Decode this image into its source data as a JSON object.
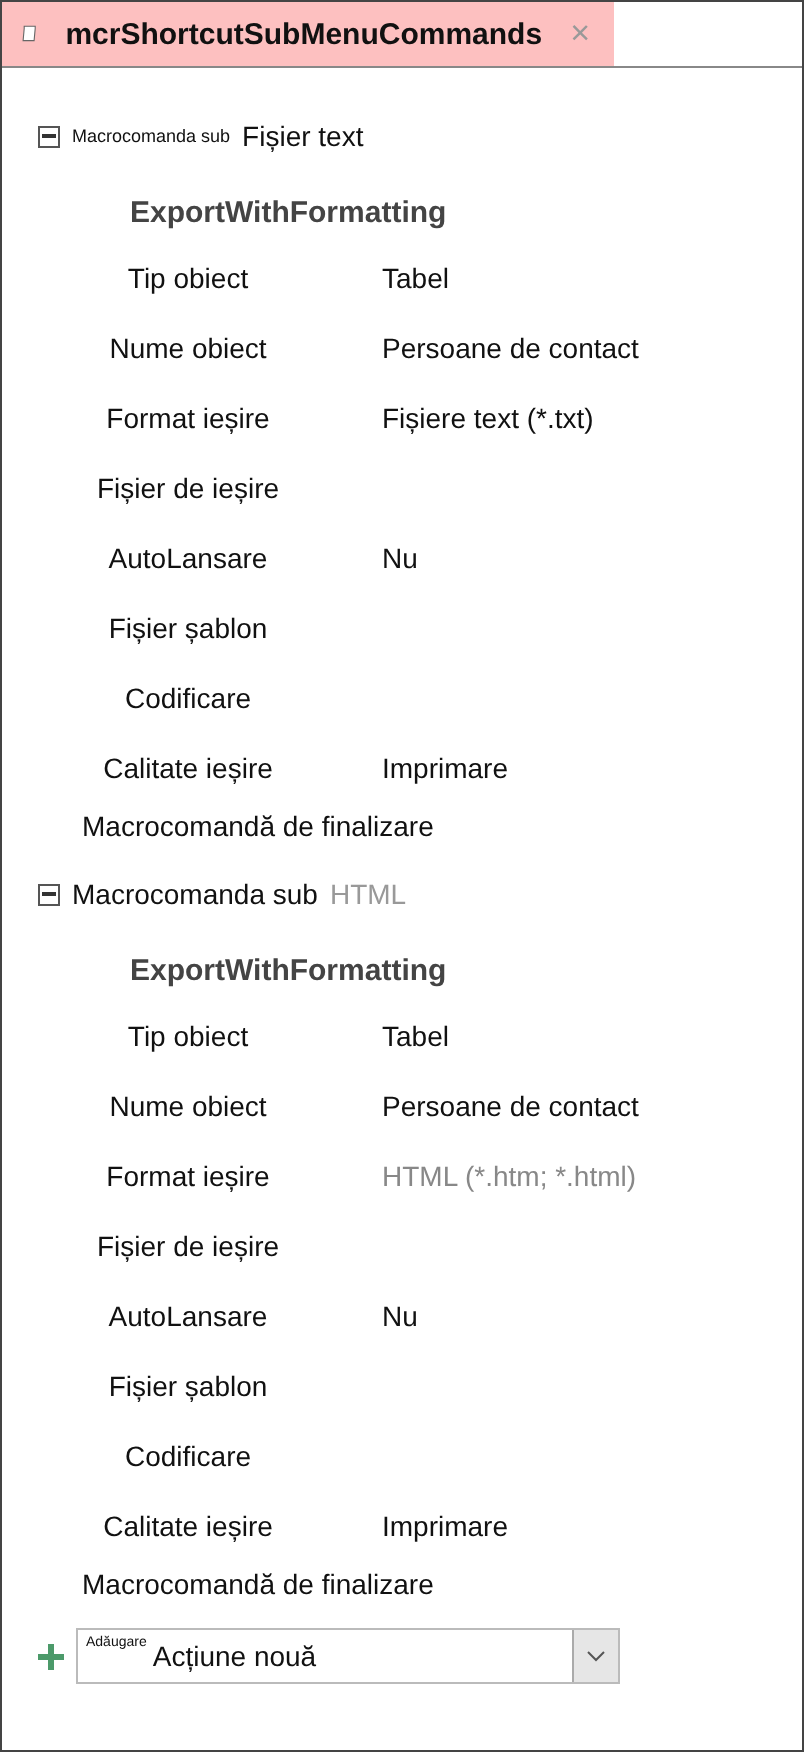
{
  "tab": {
    "title": "mcrShortcutSubMenuCommands",
    "close": "×",
    "selected": true
  },
  "submacros": [
    {
      "expanded": true,
      "label": "Macrocomanda sub",
      "label_small": true,
      "name": "Fișier text",
      "name_dimmed": false,
      "action": "ExportWithFormatting",
      "arguments": [
        {
          "label": "Tip obiect",
          "value": "Tabel",
          "dimmed": false
        },
        {
          "label": "Nume obiect",
          "value": "Persoane de contact",
          "dimmed": false
        },
        {
          "label": "Format ieșire",
          "value": "Fișiere text (*.txt)",
          "dimmed": false
        },
        {
          "label": "Fișier de ieșire"
        },
        {
          "label": "AutoLansare",
          "value": "Nu",
          "dimmed": false
        },
        {
          "label": "Fișier șablon"
        },
        {
          "label": "Codificare"
        },
        {
          "label": "Calitate ieșire",
          "value": "Imprimare",
          "dimmed": false
        }
      ],
      "end": "Macrocomandă de finalizare"
    },
    {
      "expanded": true,
      "label": "Macrocomanda sub",
      "label_small": false,
      "name": "HTML",
      "name_dimmed": true,
      "action": "ExportWithFormatting",
      "arguments": [
        {
          "label": "Tip obiect",
          "value": "Tabel",
          "dimmed": false
        },
        {
          "label": "Nume obiect",
          "value": "Persoane de contact",
          "dimmed": false
        },
        {
          "label": "Format ieșire",
          "value": "HTML (*.htm; *.html)",
          "dimmed": true
        },
        {
          "label": "Fișier de ieșire"
        },
        {
          "label": "AutoLansare",
          "value": "Nu",
          "dimmed": false
        },
        {
          "label": "Fișier șablon"
        },
        {
          "label": "Codificare"
        },
        {
          "label": "Calitate ieșire",
          "value": "Imprimare",
          "dimmed": false
        }
      ],
      "end": "Macrocomandă de finalizare"
    }
  ],
  "add_action": {
    "label": "Adăugare",
    "value": "Acțiune nouă"
  }
}
